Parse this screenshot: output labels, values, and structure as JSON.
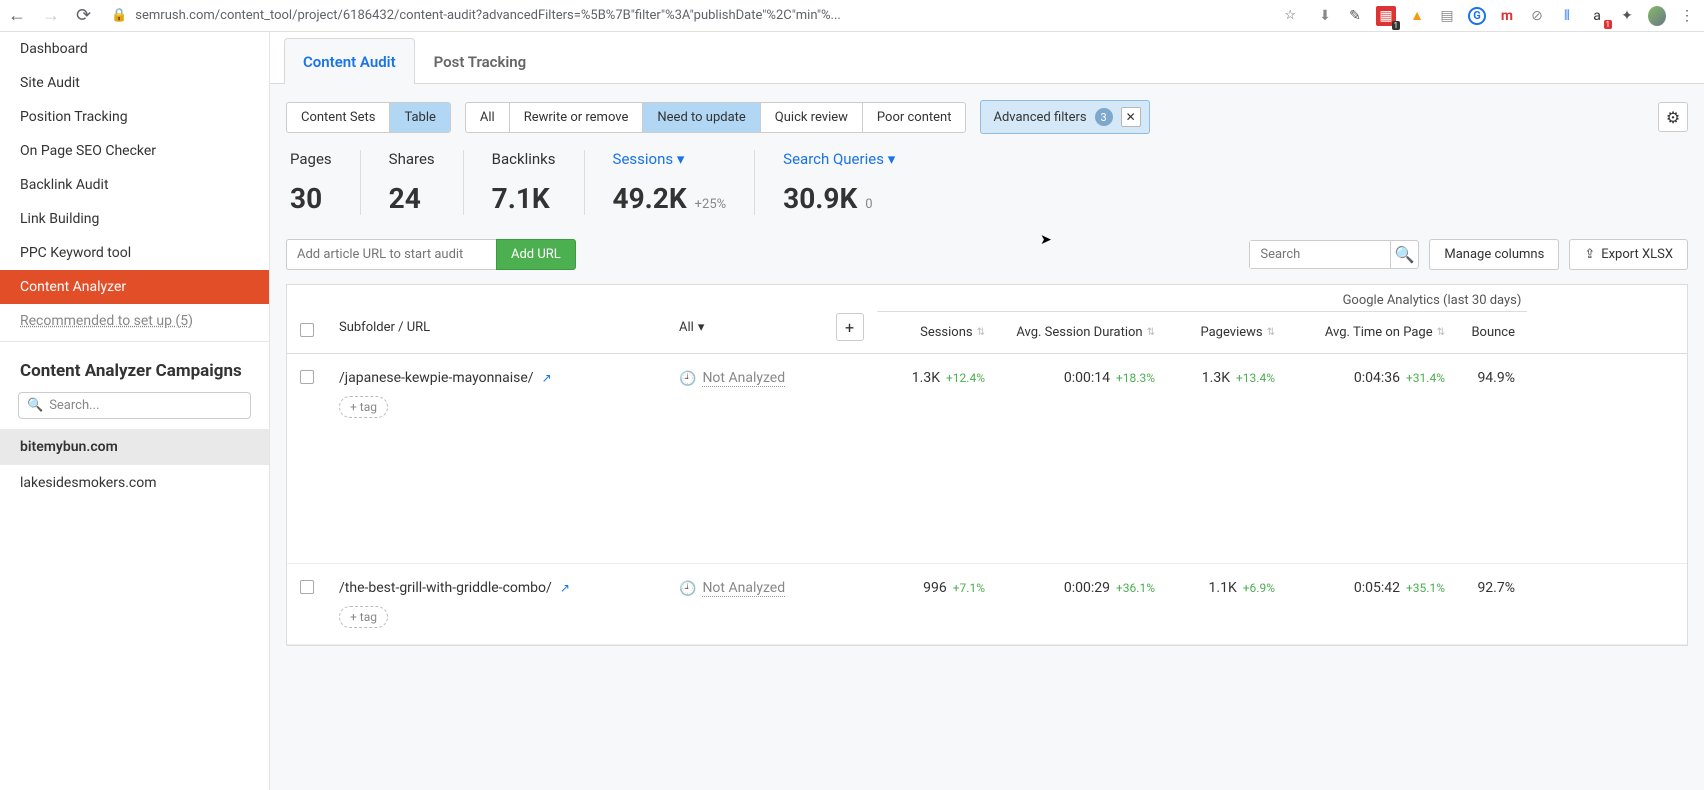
{
  "chrome": {
    "url": "semrush.com/content_tool/project/6186432/content-audit?advancedFilters=%5B%7B\"filter\"%3A\"publishDate\"%2C\"min\"%..."
  },
  "sidebar": {
    "nav": [
      "Dashboard",
      "Site Audit",
      "Position Tracking",
      "On Page SEO Checker",
      "Backlink Audit",
      "Link Building",
      "PPC Keyword tool",
      "Content Analyzer"
    ],
    "recommend": "Recommended to set up (5)",
    "campaigns_heading": "Content Analyzer Campaigns",
    "search_placeholder": "Search...",
    "campaigns": [
      "bitemybun.com",
      "lakesidesmokers.com"
    ]
  },
  "tabs": {
    "content_audit": "Content Audit",
    "post_tracking": "Post Tracking"
  },
  "view": {
    "content_sets": "Content Sets",
    "table": "Table"
  },
  "filters": {
    "all": "All",
    "rewrite": "Rewrite or remove",
    "need_update": "Need to update",
    "quick": "Quick review",
    "poor": "Poor content"
  },
  "adv": {
    "label": "Advanced filters",
    "count": "3"
  },
  "stats": {
    "pages": {
      "label": "Pages",
      "value": "30"
    },
    "shares": {
      "label": "Shares",
      "value": "24"
    },
    "backlinks": {
      "label": "Backlinks",
      "value": "7.1K"
    },
    "sessions": {
      "label": "Sessions",
      "value": "49.2K",
      "delta": "+25%"
    },
    "queries": {
      "label": "Search Queries",
      "value": "30.9K",
      "delta": "0"
    }
  },
  "actions": {
    "url_placeholder": "Add article URL to start audit",
    "add_url": "Add URL",
    "search_placeholder": "Search",
    "manage": "Manage columns",
    "export": "Export XLSX"
  },
  "table": {
    "ga_header": "Google Analytics (last 30 days)",
    "headers": {
      "subfolder": "Subfolder / URL",
      "all": "All",
      "sessions": "Sessions",
      "asd": "Avg. Session Duration",
      "pv": "Pageviews",
      "atp": "Avg. Time on Page",
      "bounce": "Bounce"
    },
    "tag_label": "+ tag",
    "not_analyzed": "Not Analyzed",
    "rows": [
      {
        "url": "/japanese-kewpie-mayonnaise/",
        "sessions": "1.3K",
        "sessions_d": "+12.4%",
        "asd": "0:00:14",
        "asd_d": "+18.3%",
        "pv": "1.3K",
        "pv_d": "+13.4%",
        "atp": "0:04:36",
        "atp_d": "+31.4%",
        "bounce": "94.9%"
      },
      {
        "url": "/the-best-grill-with-griddle-combo/",
        "sessions": "996",
        "sessions_d": "+7.1%",
        "asd": "0:00:29",
        "asd_d": "+36.1%",
        "pv": "1.1K",
        "pv_d": "+6.9%",
        "atp": "0:05:42",
        "atp_d": "+35.1%",
        "bounce": "92.7%"
      }
    ]
  }
}
